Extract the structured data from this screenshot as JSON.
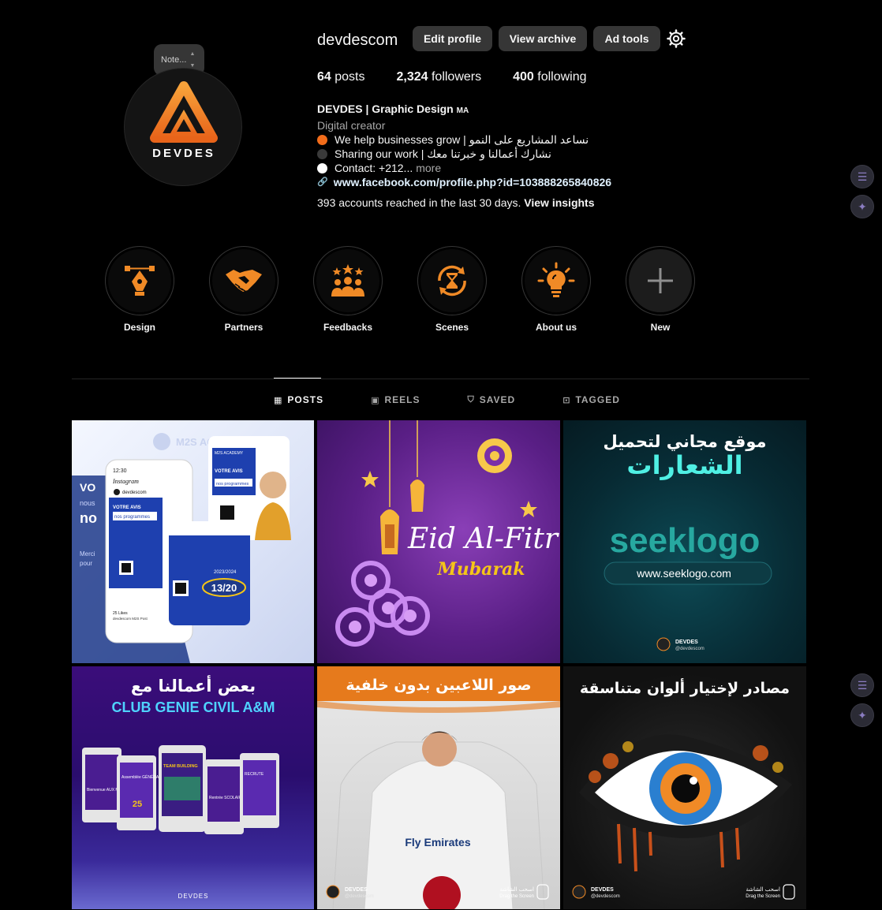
{
  "note": {
    "label": "Note..."
  },
  "profile": {
    "username": "devdescom",
    "buttons": {
      "edit": "Edit profile",
      "archive": "View archive",
      "ad_tools": "Ad tools"
    },
    "avatar_text": "DEVDES",
    "stats": [
      {
        "num": "64",
        "label": " posts"
      },
      {
        "num": "2,324",
        "label": " followers"
      },
      {
        "num": "400",
        "label": " following"
      }
    ],
    "bio": {
      "name": "DEVDES | Graphic Design",
      "name_suffix": "MA",
      "category": "Digital creator",
      "lines": [
        {
          "text": "We help businesses grow | نساعد المشاريع على النمو",
          "dot": "#f26c1a"
        },
        {
          "text": "Sharing our work | نشارك أعمالنا و خبرتنا معك",
          "dot": "#3a3a3a"
        },
        {
          "text": "Contact: +212...",
          "dot": "#ffffff"
        }
      ],
      "more": "more",
      "link": "www.facebook.com/profile.php?id=103888265840826"
    },
    "insights": {
      "text": "393 accounts reached in the last 30 days. ",
      "link": "View insights"
    }
  },
  "highlights": [
    {
      "label": "Design"
    },
    {
      "label": "Partners"
    },
    {
      "label": "Feedbacks"
    },
    {
      "label": "Scenes"
    },
    {
      "label": "About us"
    },
    {
      "label": "New"
    }
  ],
  "tabs": [
    {
      "label": "POSTS",
      "icon": "grid-icon"
    },
    {
      "label": "REELS",
      "icon": "reels-icon"
    },
    {
      "label": "SAVED",
      "icon": "bookmark-icon"
    },
    {
      "label": "TAGGED",
      "icon": "tag-icon"
    }
  ],
  "posts": {
    "p1": {
      "brand": "M2S ACA",
      "time": "12:30",
      "app": "Instagram",
      "user": "devdescom",
      "sub": "M2S",
      "header1": "VOTRE AVIS",
      "header2": "nos programmes",
      "academy": "M2S ACADEMY",
      "rating": "13/20",
      "year": "2023/2024",
      "likes": "25 Likes",
      "caption": "devdescom M2S Post",
      "bg_words": "VO",
      "bg_words2": "nous",
      "bg_words3": "no",
      "merci": "Merci",
      "pour": "pour"
    },
    "p2": {
      "title": "Eid Al-Fitr",
      "subtitle": "Mubarak"
    },
    "p3": {
      "title_ar1": "موقع مجاني لتحميل",
      "title_ar2": "الشعارات",
      "logo": "seeklogo",
      "url": "www.seeklogo.com",
      "brand": "DEVDES",
      "handle": "@devdescom"
    },
    "p4": {
      "title_ar": "بعض أعمالنا مع",
      "title_en": "CLUB GENIE CIVIL A&M",
      "card1": "Bienvenue AUX MEMBRES ADM",
      "card2": "Assemblée GÉNÉRALE",
      "card2_num": "25",
      "card3": "TEAM BUILDING",
      "card4": "Rentrée SCOLAIRE",
      "card5": "RECRUTE",
      "brand": "DEVDES"
    },
    "p5": {
      "title_ar": "صور اللاعبين بدون خلفية",
      "jersey": "Fly Emirates",
      "brand": "DEVDES",
      "handle": "@devdescom",
      "swipe_ar": "اسحب الشاشة",
      "swipe_en": "Drag the Screen"
    },
    "p6": {
      "title_ar": "مصادر لإختيار ألوان متناسقة",
      "brand": "DEVDES",
      "handle": "@devdescom",
      "swipe_ar": "اسحب الشاشة",
      "swipe_en": "Drag the Screen"
    }
  }
}
